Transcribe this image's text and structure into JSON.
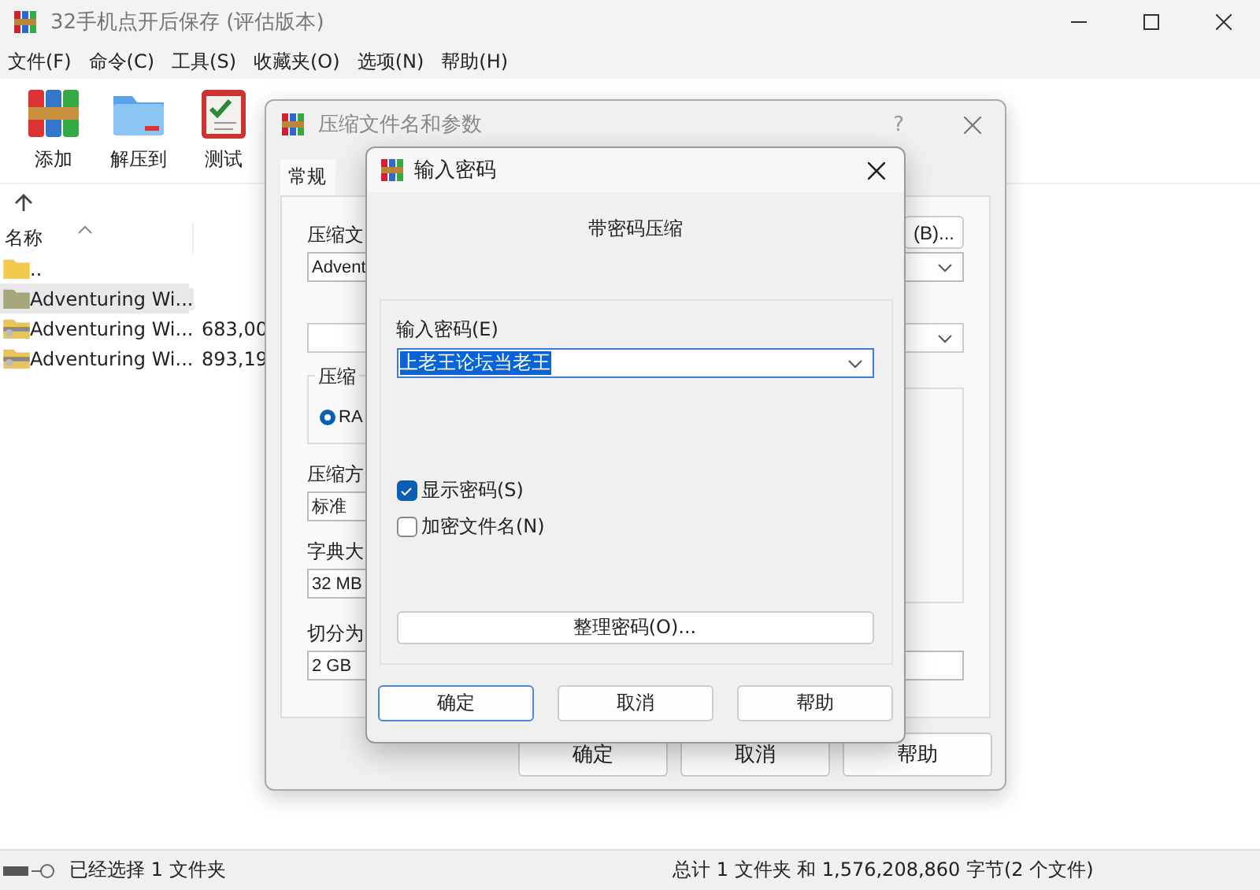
{
  "window": {
    "title": "32手机点开后保存 (评估版本)"
  },
  "menu": [
    "文件(F)",
    "命令(C)",
    "工具(S)",
    "收藏夹(O)",
    "选项(N)",
    "帮助(H)"
  ],
  "toolbar": [
    {
      "label": "添加",
      "kind": "archive"
    },
    {
      "label": "解压到",
      "kind": "folder"
    },
    {
      "label": "测试",
      "kind": "test"
    }
  ],
  "file_list": {
    "columns": [
      "名称"
    ],
    "rows": [
      {
        "name": "..",
        "kind": "up",
        "selected": false
      },
      {
        "name": "Adventuring Wi...",
        "kind": "folder",
        "selected": true
      },
      {
        "name": "Adventuring Wi...",
        "kind": "archive",
        "size": "683,00",
        "selected": false
      },
      {
        "name": "Adventuring Wi...",
        "kind": "archive",
        "size": "893,19",
        "selected": false
      }
    ]
  },
  "status_bar": {
    "left": "已经选择 1 文件夹",
    "right": "总计 1 文件夹 和 1,576,208,860 字节(2 个文件)"
  },
  "archive_dialog": {
    "title": "压缩文件名和参数",
    "help": "?",
    "tabs": [
      {
        "label": "常规",
        "selected": true
      }
    ],
    "name_label": "压缩文",
    "browse": "(B)...",
    "name_value": "Advent",
    "format_label": "压缩",
    "format_option": {
      "label": "RA",
      "selected": true
    },
    "method_label": "压缩方",
    "method_value": "标准",
    "dict_label": "字典大",
    "dict_value": "32 MB",
    "split_label": "切分为",
    "split_value": "2 GB",
    "buttons": [
      "确定",
      "取消",
      "帮助"
    ]
  },
  "password_dialog": {
    "title": "输入密码",
    "heading": "带密码压缩",
    "field_label": "输入密码(E)",
    "password": "上老王论坛当老王",
    "options": [
      {
        "label": "显示密码(S)",
        "checked": true
      },
      {
        "label": "加密文件名(N)",
        "checked": false
      }
    ],
    "organize": "整理密码(O)...",
    "buttons": [
      "确定",
      "取消",
      "帮助"
    ]
  }
}
